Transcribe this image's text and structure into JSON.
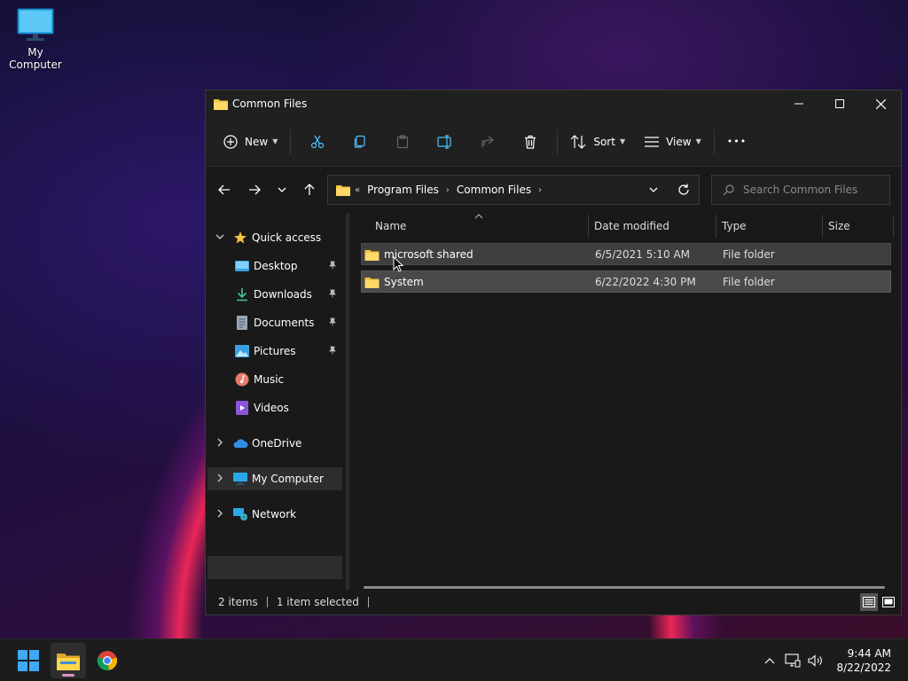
{
  "desktop": {
    "icon_label": "My Computer"
  },
  "window": {
    "title": "Common Files",
    "controls": {
      "minimize": "–",
      "maximize": "□",
      "close": "✕"
    }
  },
  "toolbar": {
    "new_label": "New",
    "sort_label": "Sort",
    "view_label": "View",
    "more_label": "•••"
  },
  "address": {
    "overflow": "«",
    "crumbs": [
      "Program Files",
      "Common Files"
    ],
    "separator": "›"
  },
  "search": {
    "placeholder": "Search Common Files"
  },
  "sidebar": {
    "items": [
      {
        "label": "Quick access"
      },
      {
        "label": "Desktop"
      },
      {
        "label": "Downloads"
      },
      {
        "label": "Documents"
      },
      {
        "label": "Pictures"
      },
      {
        "label": "Music"
      },
      {
        "label": "Videos"
      },
      {
        "label": "OneDrive"
      },
      {
        "label": "My Computer"
      },
      {
        "label": "Network"
      }
    ]
  },
  "columns": {
    "name": "Name",
    "date": "Date modified",
    "type": "Type",
    "size": "Size"
  },
  "files": [
    {
      "name": "microsoft shared",
      "date": "6/5/2021 5:10 AM",
      "type": "File folder"
    },
    {
      "name": "System",
      "date": "6/22/2022 4:30 PM",
      "type": "File folder"
    }
  ],
  "status": {
    "item_count": "2 items",
    "selected": "1 item selected"
  },
  "taskbar": {
    "time": "9:44 AM",
    "date": "8/22/2022"
  },
  "colors": {
    "folder": "#f4c542",
    "accent": "#4cc2ff"
  }
}
